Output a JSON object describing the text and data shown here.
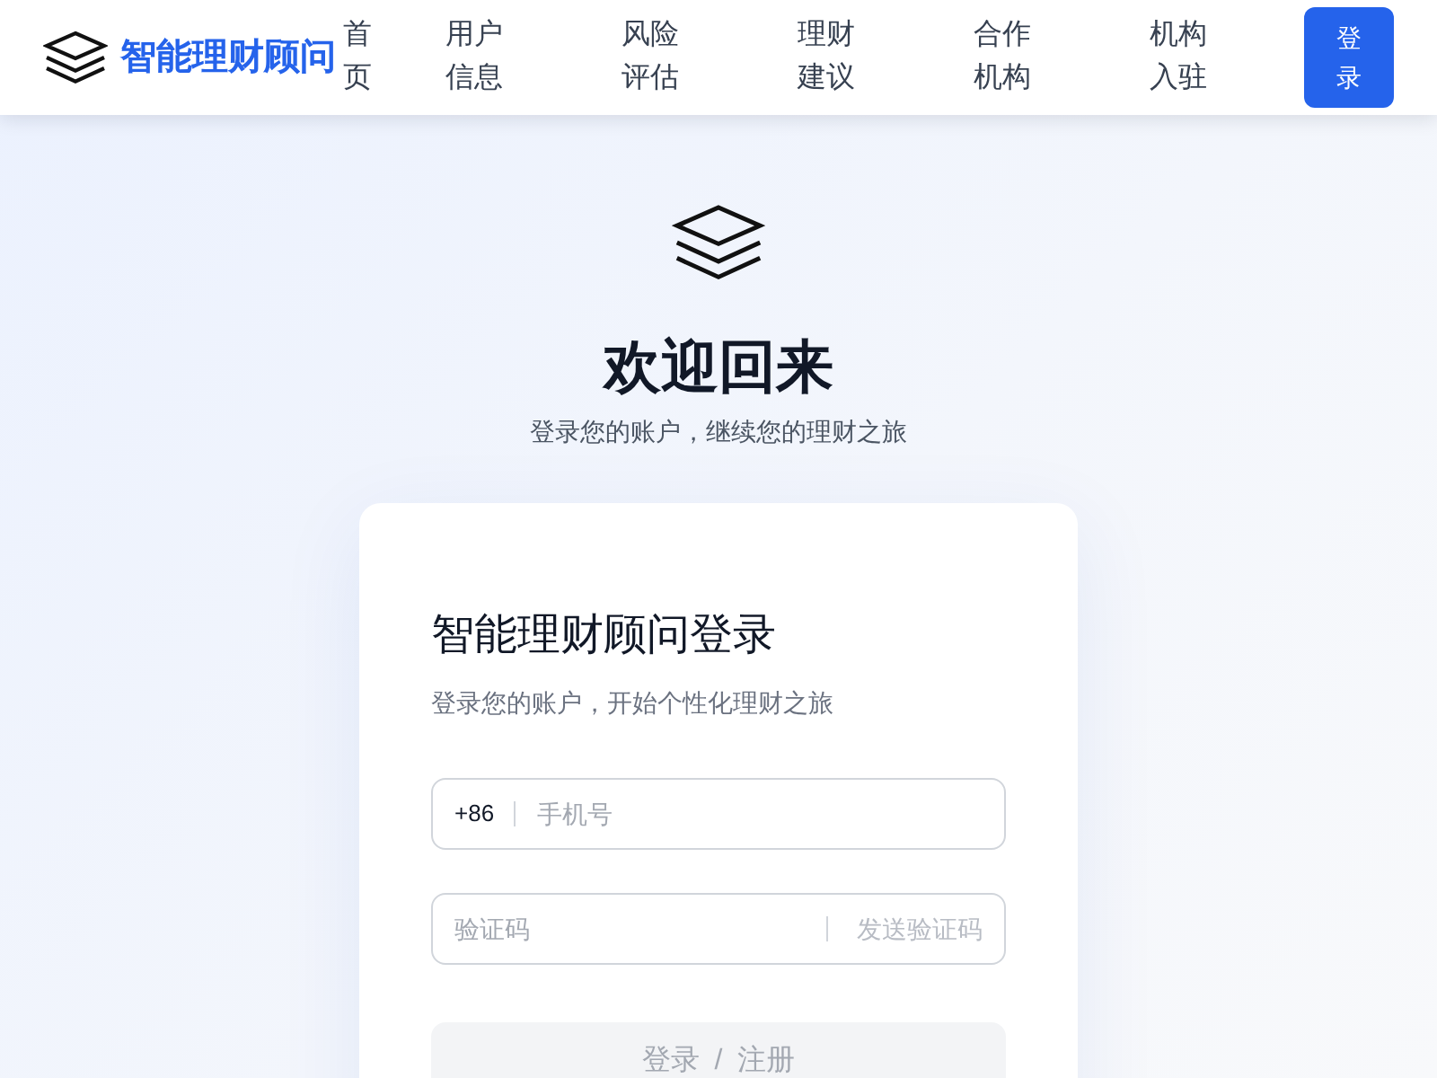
{
  "header": {
    "brand": "智能理财顾问",
    "nav": [
      "首页",
      "用户信息",
      "风险评估",
      "理财建议",
      "合作机构",
      "机构入驻"
    ],
    "login_button": "登录"
  },
  "hero": {
    "title": "欢迎回来",
    "subtitle": "登录您的账户，继续您的理财之旅"
  },
  "login_card": {
    "title": "智能理财顾问登录",
    "subtitle": "登录您的账户，开始个性化理财之旅",
    "phone_field": {
      "prefix": "+86",
      "placeholder": "手机号"
    },
    "code_field": {
      "placeholder": "验证码",
      "send_code": {
        "label": "发送验证码",
        "disabled": true
      }
    },
    "submit_button": {
      "label": "登录 / 注册",
      "disabled": true
    }
  }
}
